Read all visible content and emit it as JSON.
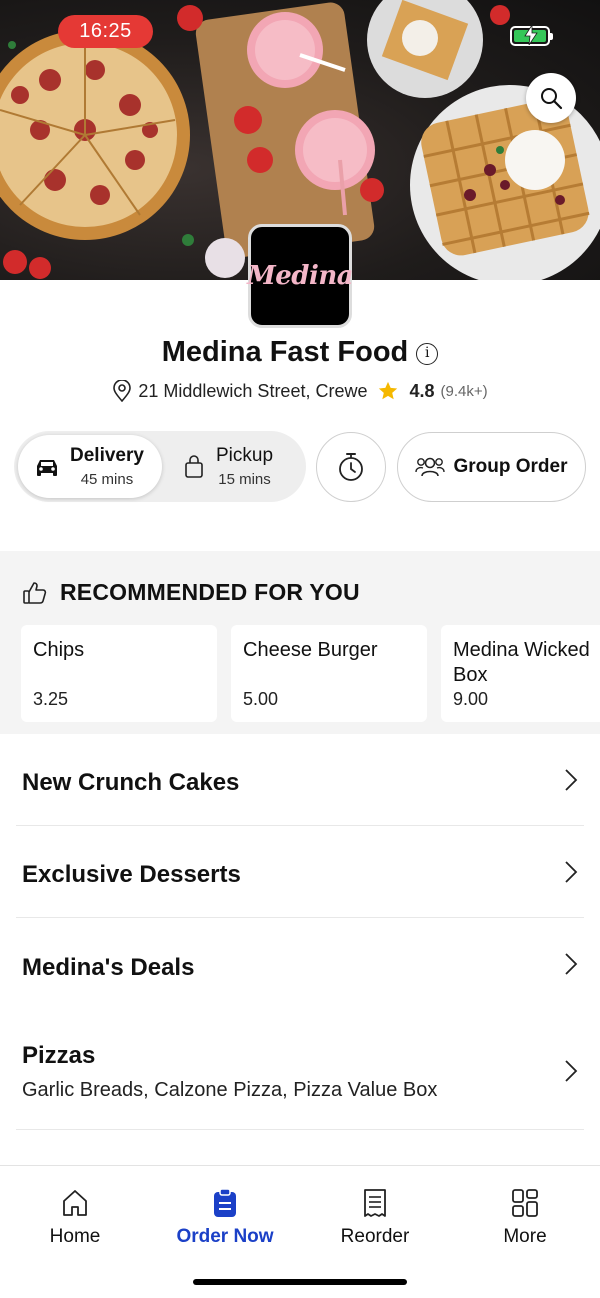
{
  "status_bar": {
    "time": "16:25"
  },
  "store": {
    "logo_text": "Medina",
    "name": "Medina Fast Food",
    "address": "21 Middlewich Street, Crewe",
    "rating": "4.8",
    "rating_count": "(9.4k+)"
  },
  "order_mode": {
    "delivery": {
      "label": "Delivery",
      "time": "45 mins"
    },
    "pickup": {
      "label": "Pickup",
      "time": "15 mins"
    },
    "group_order_label": "Group Order"
  },
  "recommended": {
    "heading": "RECOMMENDED FOR YOU",
    "items": [
      {
        "name": "Chips",
        "price": "3.25"
      },
      {
        "name": "Cheese Burger",
        "price": "5.00"
      },
      {
        "name": "Medina Wicked Box",
        "price": "9.00"
      }
    ]
  },
  "menu_categories": [
    {
      "title": "New Crunch Cakes",
      "subtitle": ""
    },
    {
      "title": "Exclusive Desserts",
      "subtitle": ""
    },
    {
      "title": "Medina's Deals",
      "subtitle": ""
    },
    {
      "title": "Pizzas",
      "subtitle": "Garlic Breads, Calzone Pizza, Pizza Value Box"
    }
  ],
  "tab_bar": {
    "tabs": [
      {
        "label": "Home",
        "icon": "home-icon"
      },
      {
        "label": "Order Now",
        "icon": "order-clipboard-icon"
      },
      {
        "label": "Reorder",
        "icon": "receipt-icon"
      },
      {
        "label": "More",
        "icon": "grid-icon"
      }
    ],
    "active_color": "#1b40c7"
  },
  "colors": {
    "time_pill": "#e53935",
    "battery": "#35c759",
    "star": "#f5b800"
  }
}
